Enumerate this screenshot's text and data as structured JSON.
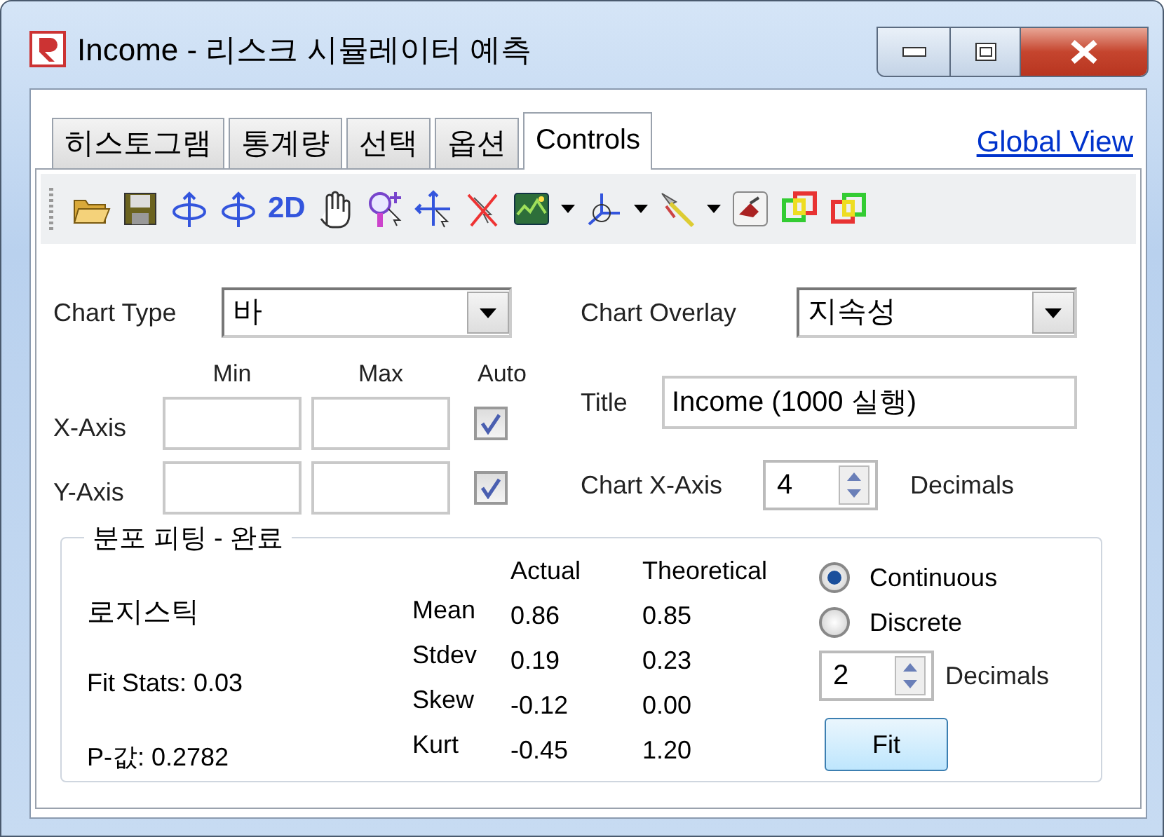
{
  "window": {
    "title": "Income - 리스크 시뮬레이터 예측"
  },
  "tabs": [
    {
      "label": "히스토그램",
      "selected": false
    },
    {
      "label": "통계량",
      "selected": false
    },
    {
      "label": "선택",
      "selected": false
    },
    {
      "label": "옵션",
      "selected": false
    },
    {
      "label": "Controls",
      "selected": true
    }
  ],
  "global_view_link": "Global View",
  "toolbar": [
    {
      "kind": "open"
    },
    {
      "kind": "save"
    },
    {
      "kind": "rotate"
    },
    {
      "kind": "rotate"
    },
    {
      "kind": "text",
      "label": "2D"
    },
    {
      "kind": "hand"
    },
    {
      "kind": "zoom"
    },
    {
      "kind": "move"
    },
    {
      "kind": "delete"
    },
    {
      "kind": "map",
      "dropdown": true
    },
    {
      "kind": "axis",
      "dropdown": true
    },
    {
      "kind": "pointer",
      "dropdown": true
    },
    {
      "kind": "brush"
    },
    {
      "kind": "overlap"
    },
    {
      "kind": "overlap2"
    }
  ],
  "chart_type": {
    "label": "Chart Type",
    "value": "바"
  },
  "chart_overlay": {
    "label": "Chart Overlay",
    "value": "지속성"
  },
  "axes": {
    "headers": [
      "Min",
      "Max",
      "Auto"
    ],
    "rows": [
      {
        "label": "X-Axis",
        "auto": true
      },
      {
        "label": "Y-Axis",
        "auto": true
      }
    ]
  },
  "title_field": {
    "label": "Title",
    "value": "Income (1000 실행)"
  },
  "chart_x_axis": {
    "label": "Chart X-Axis",
    "value": "4",
    "suffix": "Decimals"
  },
  "fitting": {
    "legend": "분포 피팅 - 완료",
    "distribution": "로지스틱",
    "fit_stats": "Fit Stats: 0.03",
    "p_value": "P-값: 0.2782",
    "columns": [
      "Actual",
      "Theoretical"
    ],
    "rows": [
      {
        "label": "Mean",
        "actual": "0.86",
        "theoretical": "0.85"
      },
      {
        "label": "Stdev",
        "actual": "0.19",
        "theoretical": "0.23"
      },
      {
        "label": "Skew",
        "actual": "-0.12",
        "theoretical": "0.00"
      },
      {
        "label": "Kurt",
        "actual": "-0.45",
        "theoretical": "1.20"
      }
    ],
    "modes": [
      {
        "label": "Continuous",
        "selected": true
      },
      {
        "label": "Discrete",
        "selected": false
      }
    ],
    "decimals": {
      "value": "2",
      "label": "Decimals"
    },
    "fit_button": "Fit"
  }
}
